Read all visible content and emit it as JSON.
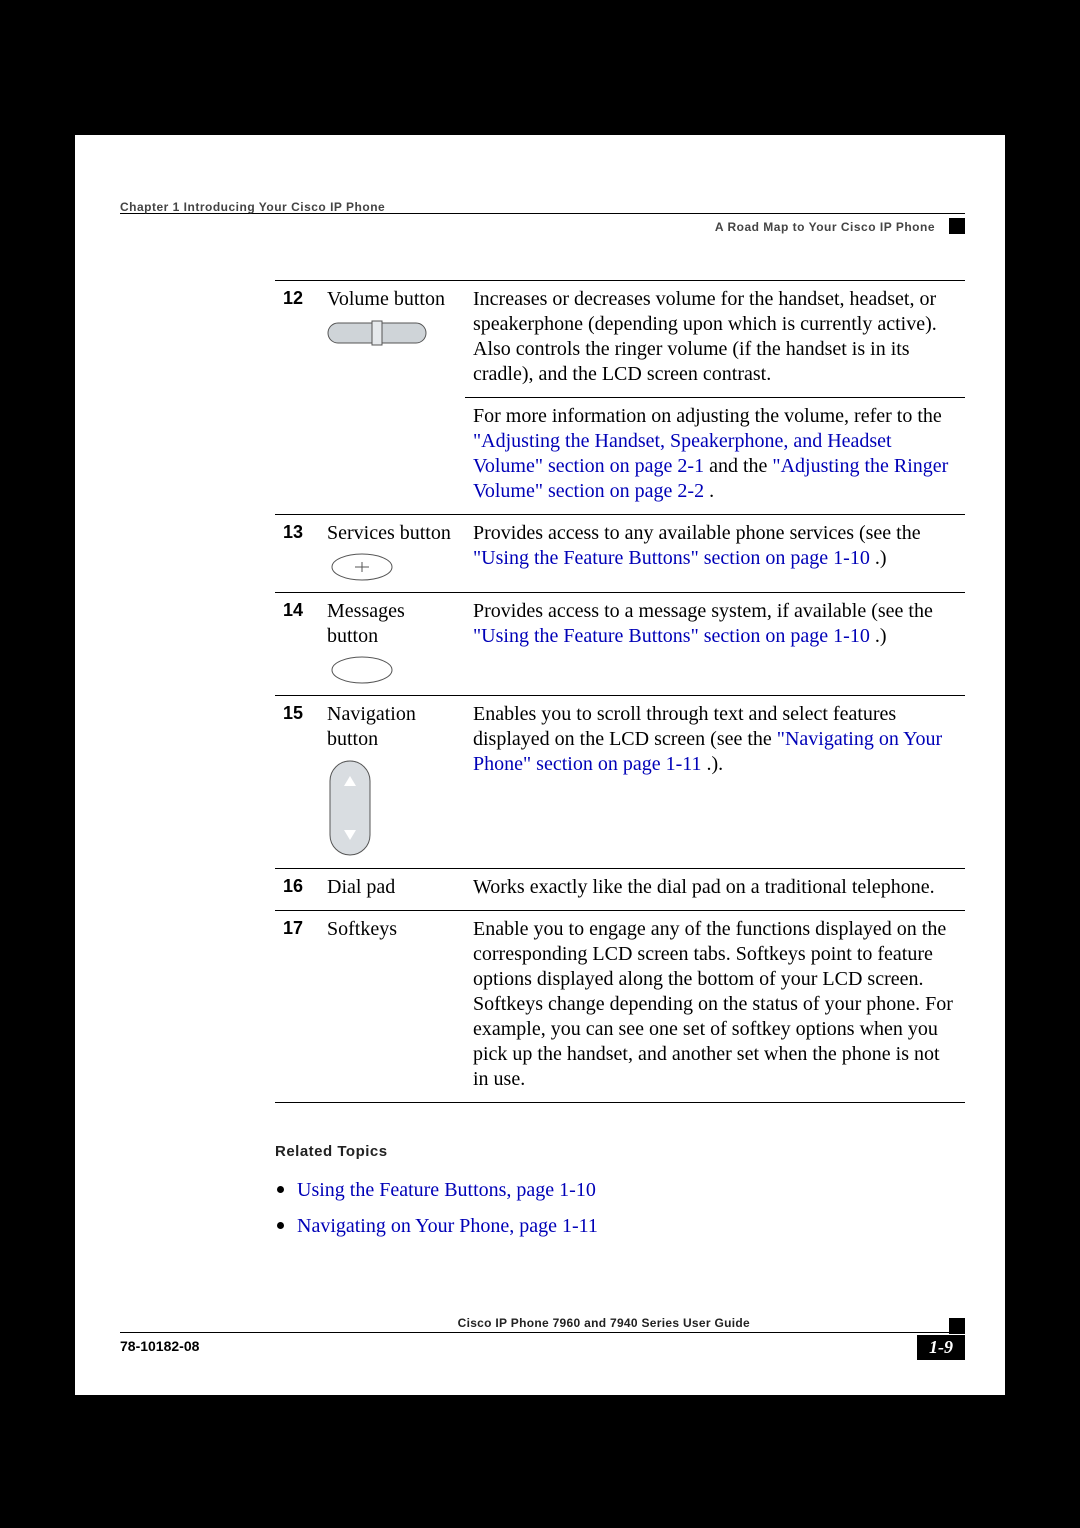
{
  "header": {
    "left": "Chapter 1    Introducing Your Cisco IP Phone",
    "right": "A Road Map to Your Cisco IP Phone",
    "bottom_title": "Cisco IP Phone 7960 and 7940 Series User Guide",
    "doc_number": "78-10182-08",
    "page_number": "1-9"
  },
  "rows": [
    {
      "num": "12",
      "name": "Volume button",
      "icon": "volume",
      "desc_a": "Increases or decreases volume for the handset, headset, or speakerphone (depending upon which is currently active). Also controls the ringer volume (if the handset is in its cradle), and the LCD screen contrast.",
      "desc_b_pre": "For more information on adjusting the volume, refer to the ",
      "desc_b_link1": "\"Adjusting the Handset, Speakerphone, and Headset Volume\" section on page 2-1",
      "desc_b_mid": " and the ",
      "desc_b_link2": "\"Adjusting the Ringer Volume\" section on page 2-2",
      "desc_b_post": "."
    },
    {
      "num": "13",
      "name": "Services button",
      "icon": "oval",
      "desc_pre": "Provides access to any available phone services (see the ",
      "desc_link": "\"Using the Feature Buttons\" section on page 1-10",
      "desc_post": ".)"
    },
    {
      "num": "14",
      "name": "Messages button",
      "icon": "oval_plain",
      "desc_pre": "Provides access to a message system, if available (see the ",
      "desc_link": "\"Using the Feature Buttons\" section on page 1-10",
      "desc_post": ".)"
    },
    {
      "num": "15",
      "name": "Navigation button",
      "icon": "nav",
      "desc_pre": "Enables you to scroll through text and select features displayed on the LCD screen (see the ",
      "desc_link": "\"Navigating on Your Phone\" section on page 1-11",
      "desc_post": ".)."
    },
    {
      "num": "16",
      "name": "Dial pad",
      "desc": "Works exactly like the dial pad on a traditional telephone."
    },
    {
      "num": "17",
      "name": "Softkeys",
      "desc": "Enable you to engage any of the functions displayed on the corresponding LCD screen tabs. Softkeys point to feature options displayed along the bottom of your LCD screen. Softkeys change depending on the status of your phone. For example, you can see one set of softkey options when you pick up the handset, and another set when the phone is not in use."
    }
  ],
  "related": {
    "heading": "Related Topics",
    "items": [
      "Using the Feature Buttons, page 1-10",
      "Navigating on Your Phone, page 1-11"
    ]
  }
}
